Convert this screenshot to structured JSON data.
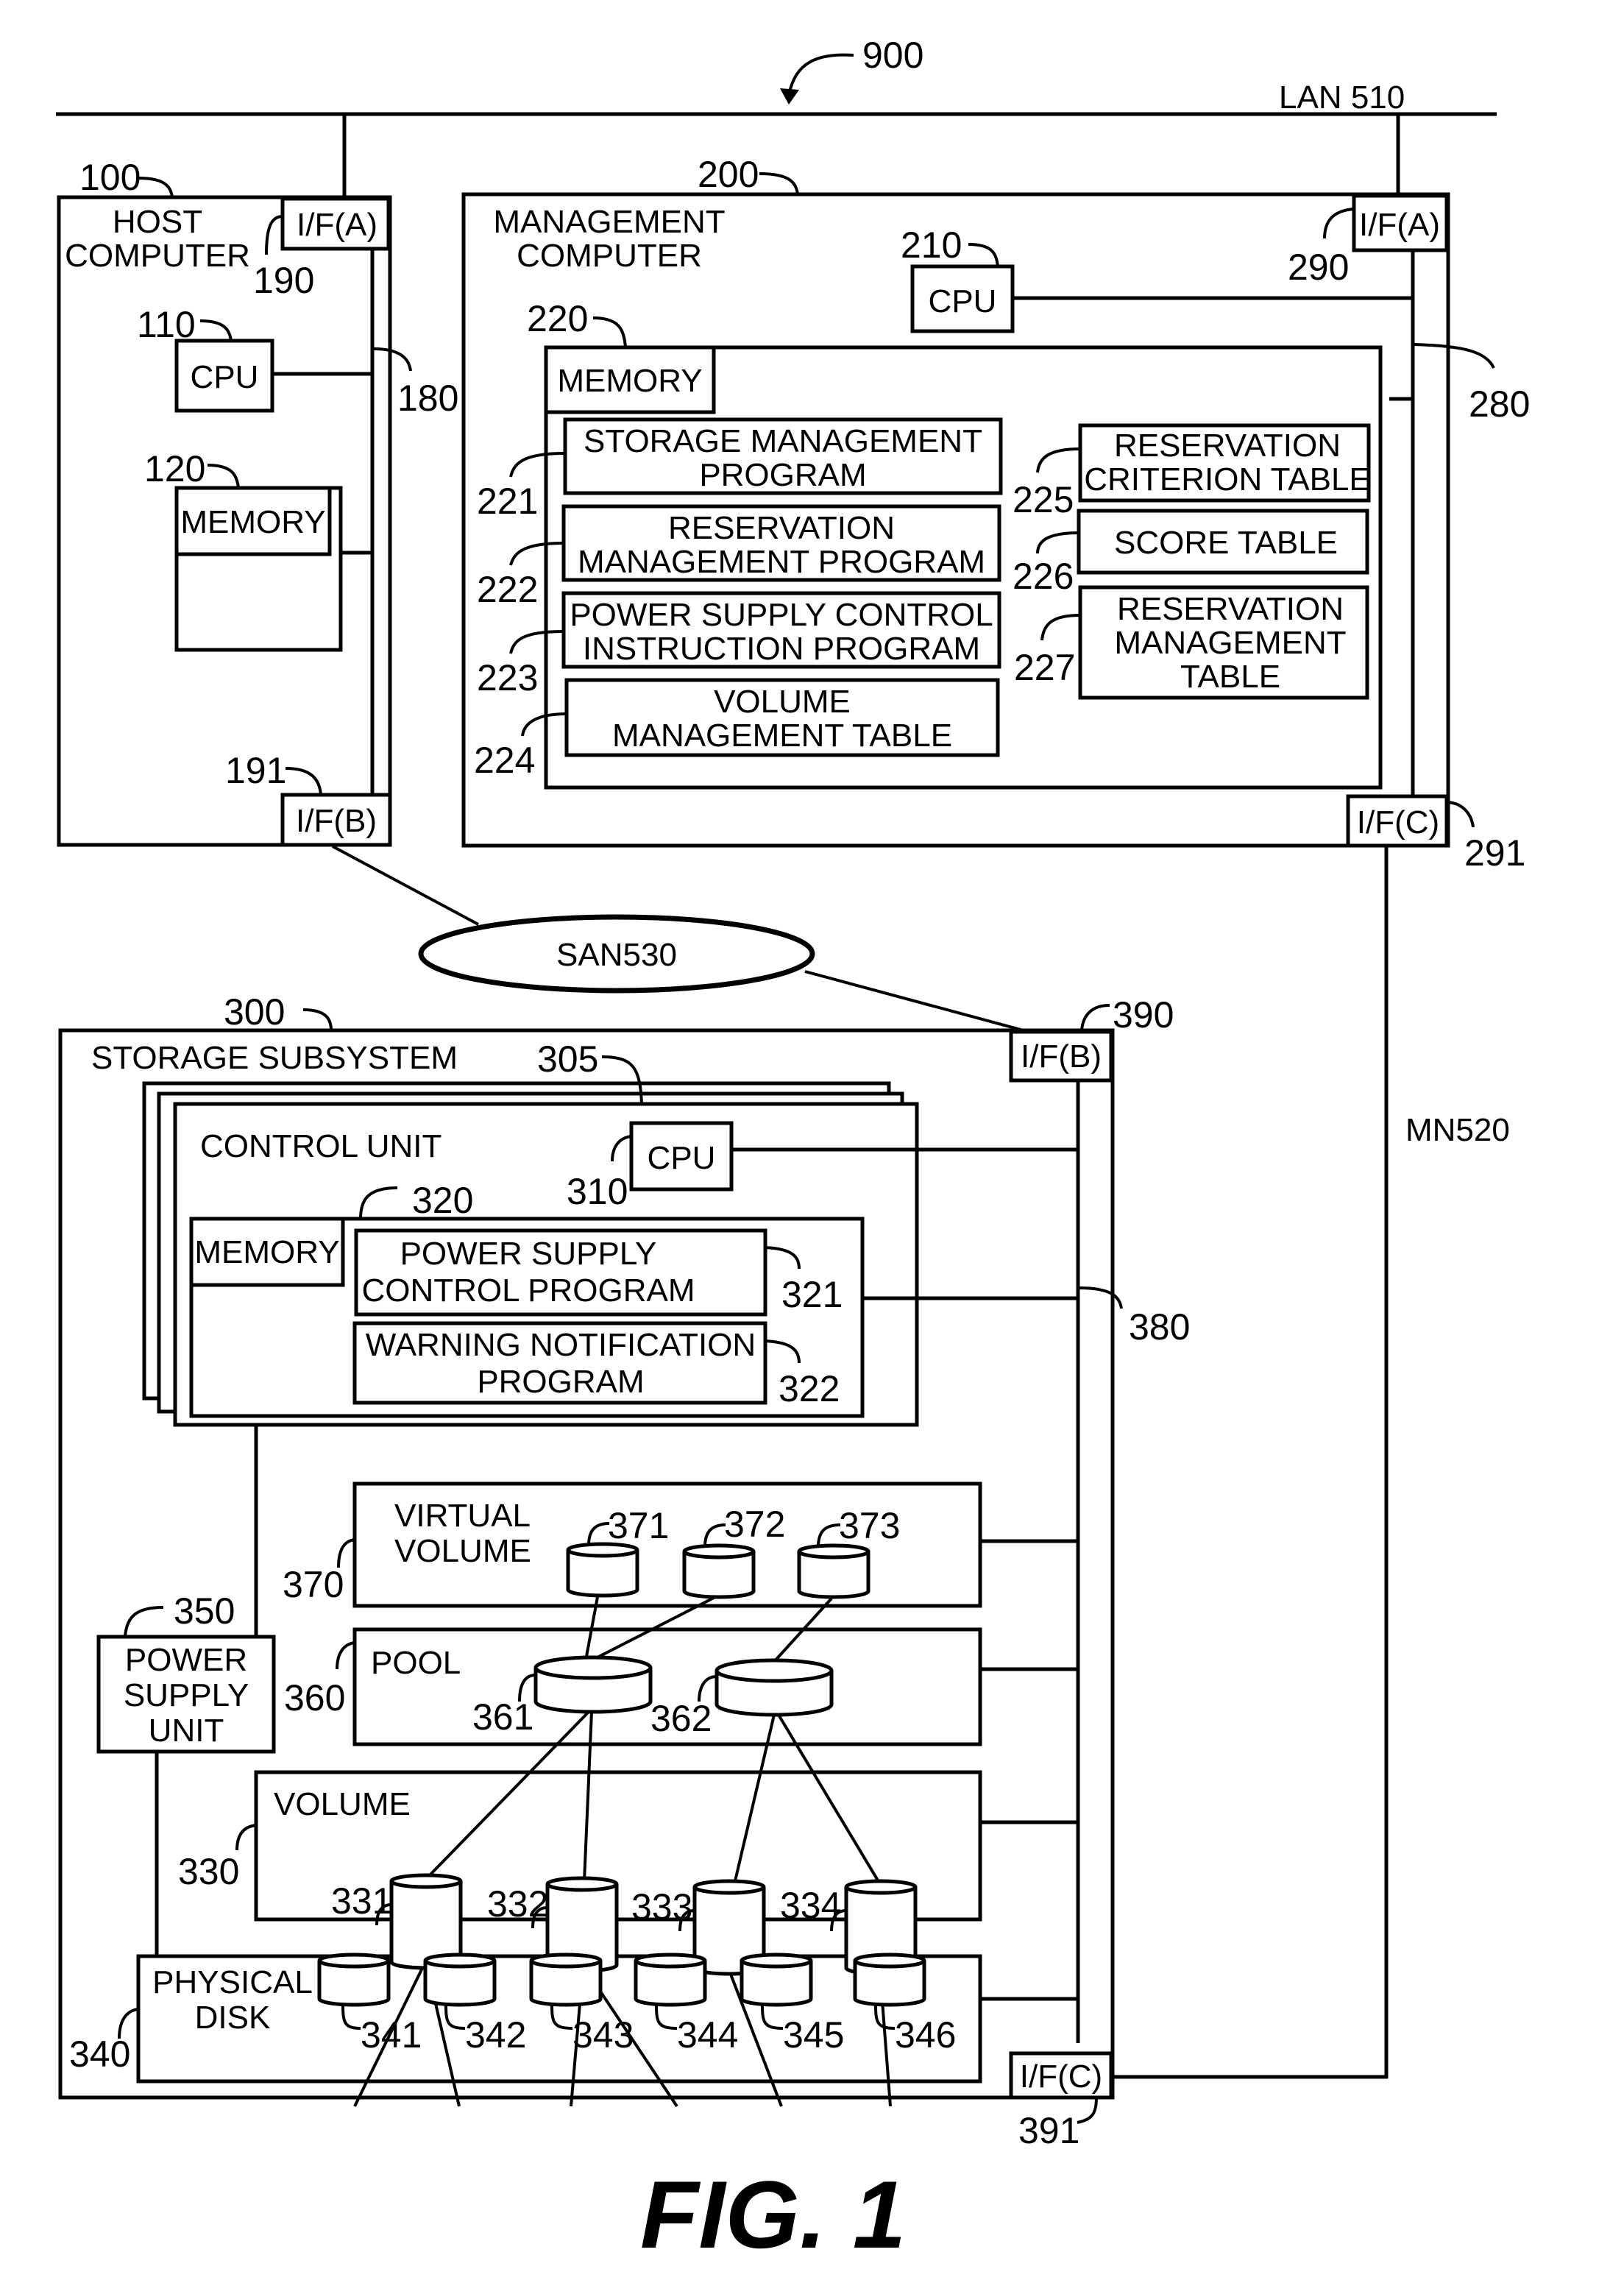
{
  "figure": {
    "system_ref": "900",
    "caption": "FIG. 1"
  },
  "networks": {
    "lan": "LAN 510",
    "san": "SAN530",
    "mn": "MN520"
  },
  "host": {
    "ref": "100",
    "title_line1": "HOST",
    "title_line2": "COMPUTER",
    "if_a": {
      "label": "I/F(A)",
      "ref": "190"
    },
    "if_b": {
      "label": "I/F(B)",
      "ref": "191"
    },
    "bus_ref": "180",
    "cpu": {
      "label": "CPU",
      "ref": "110"
    },
    "memory": {
      "label": "MEMORY",
      "ref": "120"
    }
  },
  "management": {
    "ref": "200",
    "title_line1": "MANAGEMENT",
    "title_line2": "COMPUTER",
    "if_a": {
      "label": "I/F(A)",
      "ref": "290"
    },
    "if_c": {
      "label": "I/F(C)",
      "ref": "291"
    },
    "bus_ref": "280",
    "cpu": {
      "label": "CPU",
      "ref": "210"
    },
    "memory": {
      "label": "MEMORY",
      "ref": "220"
    },
    "programs": [
      {
        "ref": "221",
        "line1": "STORAGE MANAGEMENT",
        "line2": "PROGRAM"
      },
      {
        "ref": "222",
        "line1": "RESERVATION",
        "line2": "MANAGEMENT PROGRAM"
      },
      {
        "ref": "223",
        "line1": "POWER SUPPLY CONTROL",
        "line2": "INSTRUCTION PROGRAM"
      },
      {
        "ref": "224",
        "line1": "VOLUME",
        "line2": "MANAGEMENT TABLE"
      }
    ],
    "tables": [
      {
        "ref": "225",
        "line1": "RESERVATION",
        "line2": "CRITERION TABLE",
        "line3": ""
      },
      {
        "ref": "226",
        "line1": "SCORE TABLE",
        "line2": "",
        "line3": ""
      },
      {
        "ref": "227",
        "line1": "RESERVATION",
        "line2": "MANAGEMENT",
        "line3": "TABLE"
      }
    ]
  },
  "storage": {
    "ref": "300",
    "title": "STORAGE SUBSYSTEM",
    "if_b": {
      "label": "I/F(B)",
      "ref": "390"
    },
    "if_c": {
      "label": "I/F(C)",
      "ref": "391"
    },
    "bus_ref": "380",
    "control_unit": {
      "ref": "305",
      "title": "CONTROL UNIT",
      "cpu": {
        "label": "CPU",
        "ref": "310"
      },
      "memory": {
        "label": "MEMORY",
        "ref": "320"
      },
      "programs": [
        {
          "ref": "321",
          "line1": "POWER SUPPLY",
          "line2": "CONTROL PROGRAM"
        },
        {
          "ref": "322",
          "line1": "WARNING NOTIFICATION",
          "line2": "PROGRAM"
        }
      ]
    },
    "power_supply": {
      "ref": "350",
      "line1": "POWER",
      "line2": "SUPPLY",
      "line3": "UNIT"
    },
    "virtual_volume": {
      "ref": "370",
      "line1": "VIRTUAL",
      "line2": "VOLUME",
      "disks": [
        "371",
        "372",
        "373"
      ]
    },
    "pool": {
      "ref": "360",
      "label": "POOL",
      "disks": [
        "361",
        "362"
      ]
    },
    "volume": {
      "ref": "330",
      "label": "VOLUME",
      "disks": [
        "331",
        "332",
        "333",
        "334"
      ]
    },
    "physical_disk": {
      "ref": "340",
      "line1": "PHYSICAL",
      "line2": "DISK",
      "disks": [
        "341",
        "342",
        "343",
        "344",
        "345",
        "346"
      ]
    }
  }
}
